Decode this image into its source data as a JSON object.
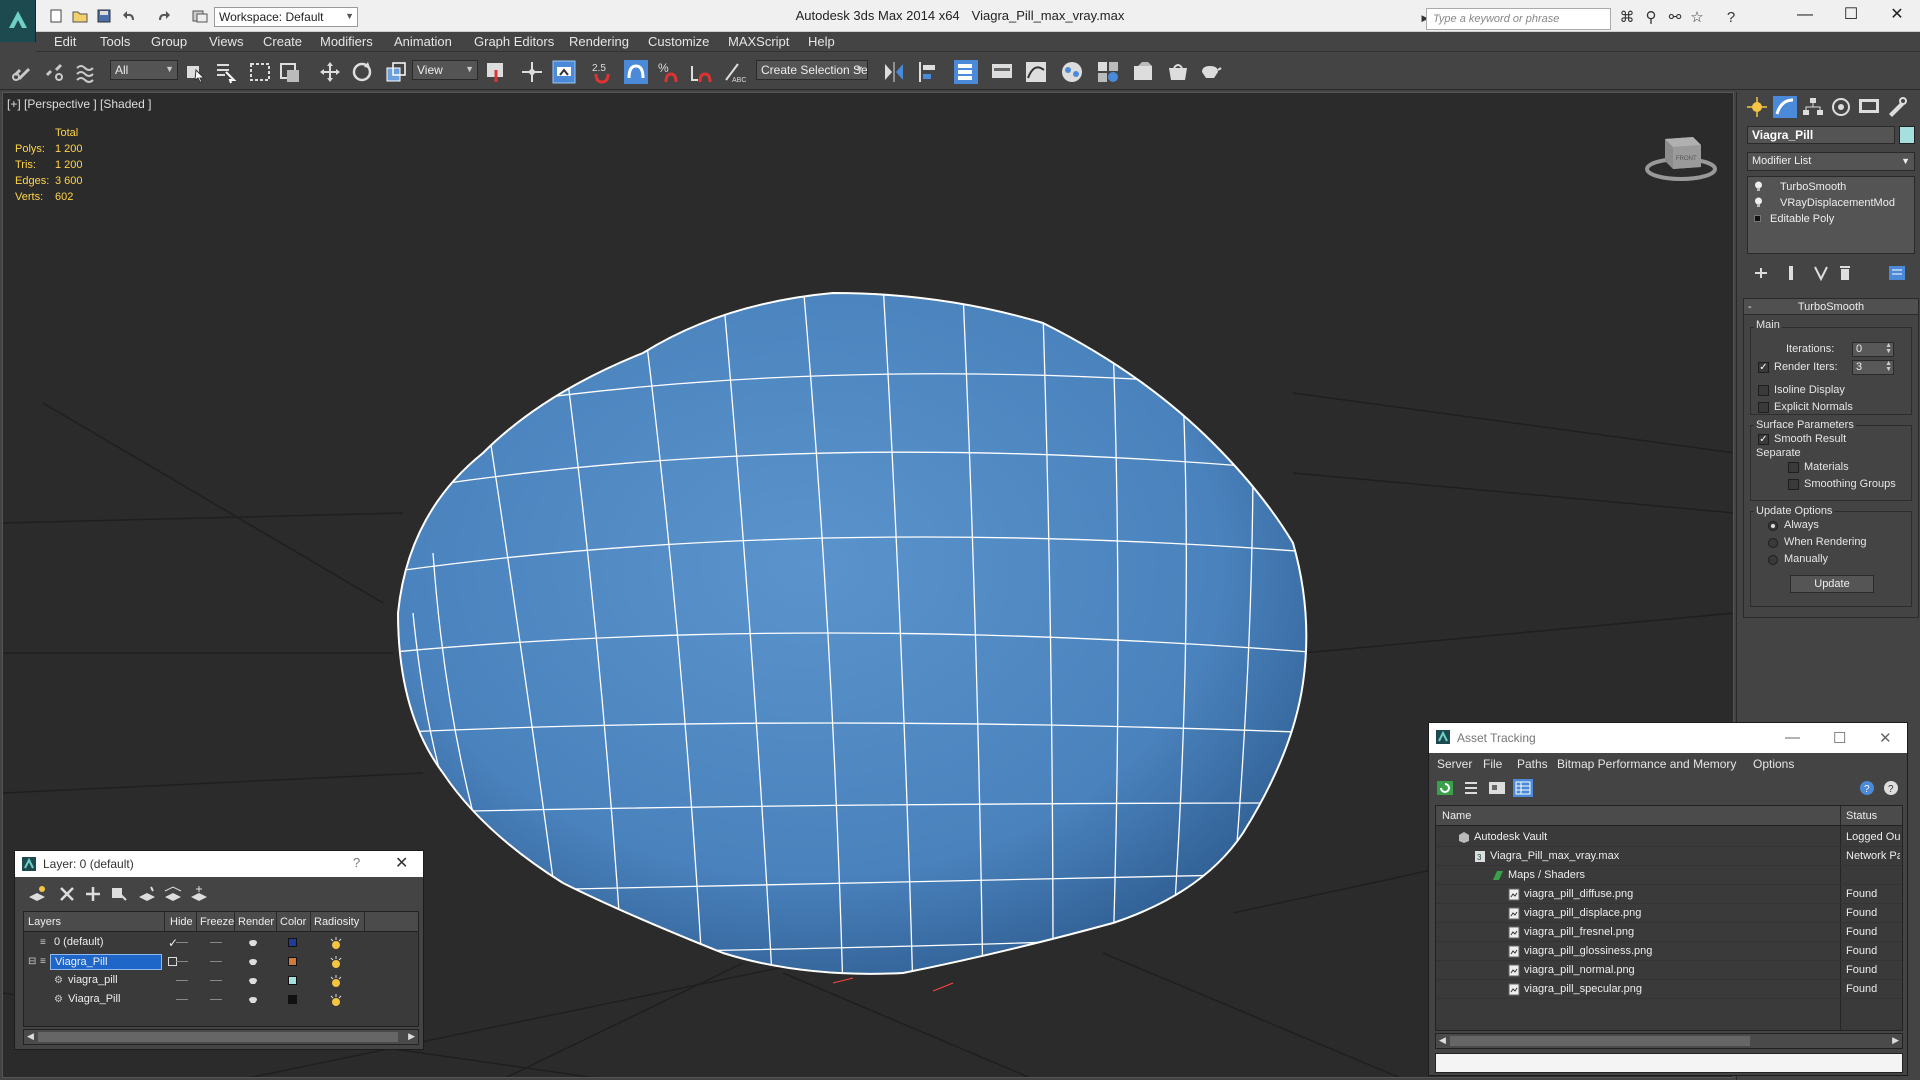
{
  "titlebar": {
    "workspace": "Workspace: Default",
    "app": "Autodesk 3ds Max  2014 x64",
    "file": "Viagra_Pill_max_vray.max",
    "search_placeholder": "Type a keyword or phrase"
  },
  "menu": [
    "Edit",
    "Tools",
    "Group",
    "Views",
    "Create",
    "Modifiers",
    "Animation",
    "Graph Editors",
    "Rendering",
    "Customize",
    "MAXScript",
    "Help"
  ],
  "toolbar": {
    "selection_filter": "All",
    "ref_coord": "View",
    "snap_value": "2.5",
    "named_selection": "Create Selection Se"
  },
  "viewport": {
    "label": "[+] [Perspective ] [Shaded ]",
    "stats": {
      "header": "Total",
      "rows": [
        {
          "k": "Polys:",
          "v": "1 200"
        },
        {
          "k": "Tris:",
          "v": "1 200"
        },
        {
          "k": "Edges:",
          "v": "3 600"
        },
        {
          "k": "Verts:",
          "v": "602"
        }
      ]
    },
    "viewcube_label": "FRONT",
    "pill_color": "#4a82bd"
  },
  "command_panel": {
    "object_name": "Viagra_Pill",
    "object_color": "#a6e0de",
    "modifier_list": "Modifier List",
    "stack": [
      "TurboSmooth",
      "VRayDisplacementMod",
      "Editable Poly"
    ],
    "turbosmooth": {
      "title": "TurboSmooth",
      "main": "Main",
      "iterations_label": "Iterations:",
      "iterations": "0",
      "render_iters_label": "Render Iters:",
      "render_iters": "3",
      "isoline": "Isoline Display",
      "explicit": "Explicit Normals",
      "surface": "Surface Parameters",
      "smooth_result": "Smooth Result",
      "separate": "Separate",
      "materials": "Materials",
      "smoothing_groups": "Smoothing Groups",
      "update_options": "Update Options",
      "always": "Always",
      "when_rendering": "When Rendering",
      "manually": "Manually",
      "update_btn": "Update"
    }
  },
  "layer_dialog": {
    "title": "Layer: 0 (default)",
    "help": "?",
    "columns": [
      "Layers",
      "Hide",
      "Freeze",
      "Render",
      "Color",
      "Radiosity"
    ],
    "rows": [
      {
        "name": "0 (default)",
        "indent": 0,
        "color": "#1f3c9a",
        "selected": false
      },
      {
        "name": "Viagra_Pill",
        "indent": 0,
        "color": "#d07a3a",
        "selected": true
      },
      {
        "name": "viagra_pill",
        "indent": 1,
        "color": "#a6e0de",
        "selected": false
      },
      {
        "name": "Viagra_Pill",
        "indent": 1,
        "color": "#111111",
        "selected": false
      }
    ]
  },
  "asset_dialog": {
    "title": "Asset Tracking",
    "menu": [
      "Server",
      "File",
      "Paths",
      "Bitmap Performance and Memory",
      "Options"
    ],
    "columns": [
      "Name",
      "Status"
    ],
    "rows": [
      {
        "name": "Autodesk Vault",
        "indent": 1,
        "status": "Logged Out",
        "icon": "vault-icon"
      },
      {
        "name": "Viagra_Pill_max_vray.max",
        "indent": 2,
        "status": "Network Path",
        "icon": "max-file-icon"
      },
      {
        "name": "Maps / Shaders",
        "indent": 3,
        "status": "",
        "icon": "maps-folder-icon"
      },
      {
        "name": "viagra_pill_diffuse.png",
        "indent": 4,
        "status": "Found",
        "icon": "image-file-icon"
      },
      {
        "name": "viagra_pill_displace.png",
        "indent": 4,
        "status": "Found",
        "icon": "image-file-icon"
      },
      {
        "name": "viagra_pill_fresnel.png",
        "indent": 4,
        "status": "Found",
        "icon": "image-file-icon"
      },
      {
        "name": "viagra_pill_glossiness.png",
        "indent": 4,
        "status": "Found",
        "icon": "image-file-icon"
      },
      {
        "name": "viagra_pill_normal.png",
        "indent": 4,
        "status": "Found",
        "icon": "image-file-icon"
      },
      {
        "name": "viagra_pill_specular.png",
        "indent": 4,
        "status": "Found",
        "icon": "image-file-icon"
      }
    ]
  }
}
